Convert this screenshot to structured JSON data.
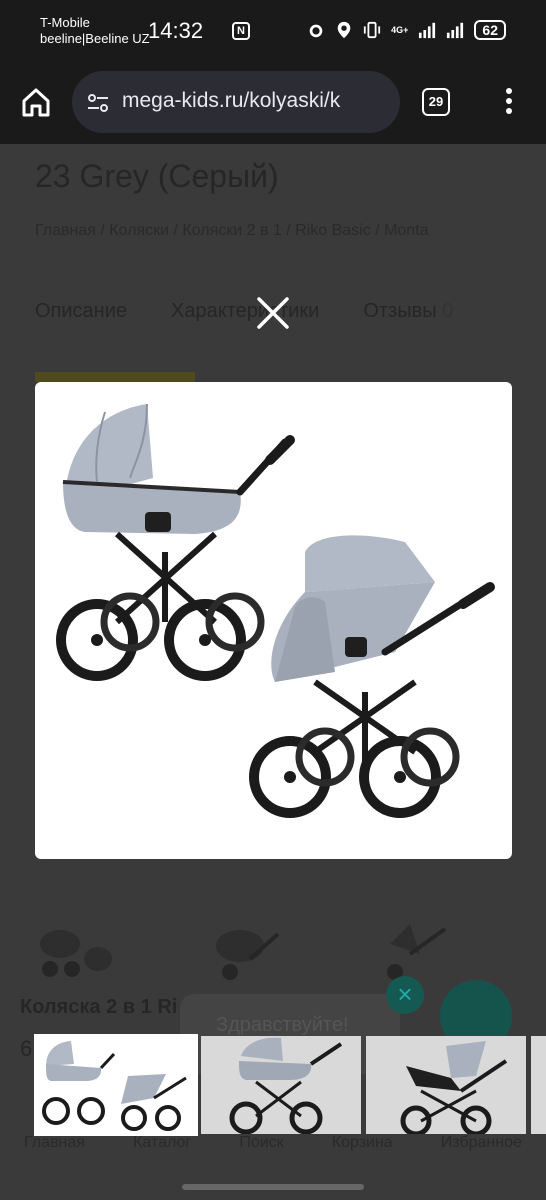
{
  "status": {
    "carrier_line1": "T-Mobile",
    "carrier_line2": "beeline|Beeline UZ",
    "time": "14:32",
    "net_label": "4G+",
    "battery": "62"
  },
  "browser": {
    "url": "mega-kids.ru/kolyaski/k",
    "tab_count": "29"
  },
  "page": {
    "title_line": "23 Grey (Серый)",
    "breadcrumb": "Главная  /  Коляски  /  Коляски 2 в 1  /  Riko Basic  /  Monta",
    "tabs": [
      {
        "label": "Описание"
      },
      {
        "label": "Характеристики"
      },
      {
        "label": "Отзывы"
      }
    ],
    "reviews_count": "0",
    "card_title": "Коляска 2 в 1 Ri",
    "card_price": "6",
    "chat_greeting": "Здравствуйте!",
    "nav": [
      "Главная",
      "Каталог",
      "Поиск",
      "Корзина",
      "Избранное"
    ]
  },
  "lightbox": {
    "main_image_alt": "stroller-carrycot-and-seat-grey",
    "thumbs": [
      {
        "name": "thumb-both-modules"
      },
      {
        "name": "thumb-carrycot"
      },
      {
        "name": "thumb-seat"
      }
    ]
  },
  "colors": {
    "stroller_fabric": "#a9b1bf",
    "frame": "#1b1b1b",
    "overlay": "#3a3a3a",
    "chat_accent": "#15544c"
  }
}
